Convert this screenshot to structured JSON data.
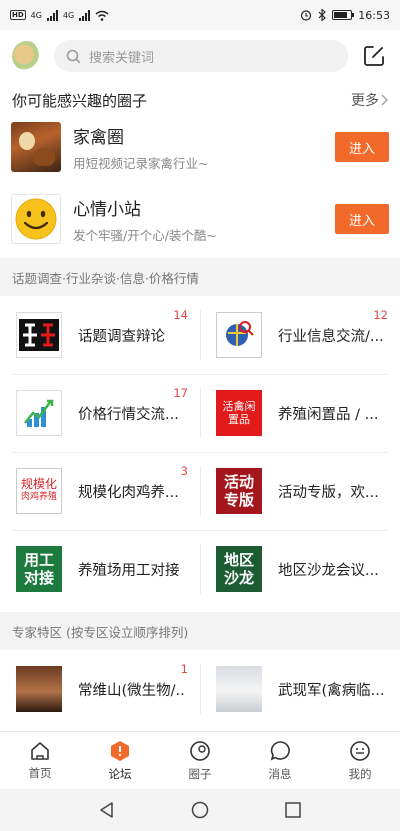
{
  "status_bar": {
    "time": "16:53",
    "net1": "4G",
    "net2": "4G",
    "battery_level": 0.8
  },
  "header": {
    "search_placeholder": "搜索关键词"
  },
  "groups": {
    "title": "你可能感兴趣的圈子",
    "more": "更多",
    "items": [
      {
        "name": "家禽圈",
        "desc": "用短视频记录家禽行业~",
        "button": "进入"
      },
      {
        "name": "心情小站",
        "desc": "发个牢骚/开个心/装个酷~",
        "button": "进入"
      }
    ]
  },
  "topics": {
    "title": "话题调查·行业杂谈·信息·价格行情",
    "items": [
      {
        "label": "话题调查辩论",
        "count": "14"
      },
      {
        "label": "行业信息交流/...",
        "count": "12"
      },
      {
        "label": "价格行情交流...",
        "count": "17"
      },
      {
        "label": "养殖闲置品 / ...",
        "count": "",
        "icon_text": "活禽闲置品"
      },
      {
        "label": "规模化肉鸡养...",
        "count": "3",
        "icon_text_1": "规模化",
        "icon_text_2": "肉鸡养殖"
      },
      {
        "label": "活动专版，欢...",
        "count": "",
        "icon_text_1": "活动",
        "icon_text_2": "专版"
      },
      {
        "label": "养殖场用工对接",
        "count": "",
        "icon_text_1": "用工",
        "icon_text_2": "对接"
      },
      {
        "label": "地区沙龙会议...",
        "count": "",
        "icon_text_1": "地区",
        "icon_text_2": "沙龙"
      }
    ]
  },
  "experts": {
    "title": "专家特区 (按专区设立顺序排列)",
    "items": [
      {
        "label": "常维山(微生物/...",
        "count": "1"
      },
      {
        "label": "武现军(禽病临...",
        "count": ""
      }
    ]
  },
  "tabs": [
    {
      "label": "首页",
      "icon": "home-icon"
    },
    {
      "label": "论坛",
      "icon": "forum-icon",
      "active": true
    },
    {
      "label": "圈子",
      "icon": "circle-icon"
    },
    {
      "label": "消息",
      "icon": "message-icon"
    },
    {
      "label": "我的",
      "icon": "profile-icon"
    }
  ],
  "colors": {
    "accent": "#f26a2b",
    "badge": "#e04848"
  }
}
